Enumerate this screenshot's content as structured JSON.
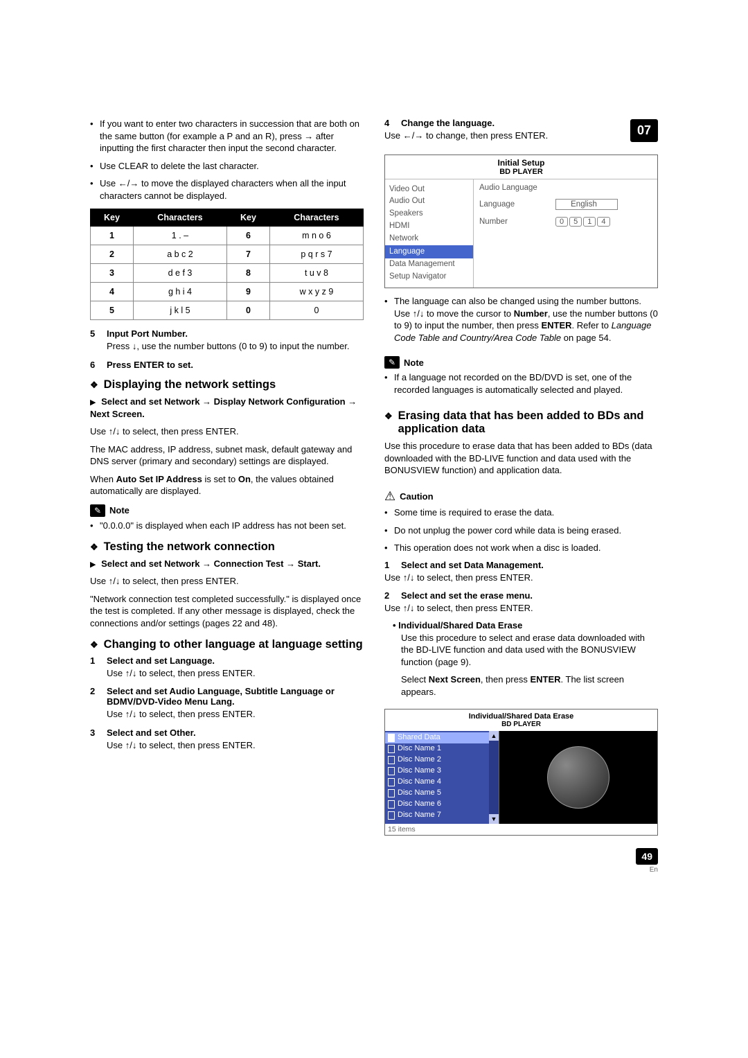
{
  "chapter": "07",
  "page_number": "49",
  "page_lang": "En",
  "left": {
    "bullets_top": [
      "If you want to enter two characters in succession that are both on the same button (for example a P and an R), press → after inputting the first character then input the second character.",
      "Use CLEAR to delete the last character.",
      "Use ←/→ to move the displayed characters when all the input characters cannot be displayed."
    ],
    "table": {
      "headers": [
        "Key",
        "Characters",
        "Key",
        "Characters"
      ],
      "rows": [
        [
          "1",
          "1 . –",
          "6",
          "m n o 6"
        ],
        [
          "2",
          "a b c 2",
          "7",
          "p q r s 7"
        ],
        [
          "3",
          "d e f 3",
          "8",
          "t u v 8"
        ],
        [
          "4",
          "g h i 4",
          "9",
          "w x y z 9"
        ],
        [
          "5",
          "j k l 5",
          "0",
          "0"
        ]
      ]
    },
    "step5": {
      "num": "5",
      "title": "Input Port Number.",
      "body": "Press ↓, use the number buttons (0 to 9) to input the number."
    },
    "step6": {
      "num": "6",
      "title": "Press ENTER to set."
    },
    "h_display": "Displaying the network settings",
    "display_sub": "Select and set Network → Display Network Configuration → Next Screen.",
    "display_use": "Use ↑/↓ to select, then press ENTER.",
    "display_p1": "The MAC address, IP address, subnet mask, default gateway and DNS server (primary and secondary) settings are displayed.",
    "display_p2a": "When ",
    "display_p2b": "Auto Set IP Address",
    "display_p2c": " is set to ",
    "display_p2d": "On",
    "display_p2e": ", the values obtained automatically are displayed.",
    "note_label": "Note",
    "display_note": "\"0.0.0.0\" is displayed when each IP address has not been set.",
    "h_test": "Testing the network connection",
    "test_sub": "Select and set Network → Connection Test → Start.",
    "test_use": "Use ↑/↓ to select, then press ENTER.",
    "test_p": "\"Network connection test completed successfully.\" is displayed once the test is completed. If any other message is displayed, check the connections and/or settings (pages 22 and 48).",
    "h_lang": "Changing to other language at language setting",
    "lang_s1": {
      "num": "1",
      "title": "Select and set Language.",
      "body": "Use ↑/↓ to select, then press ENTER."
    },
    "lang_s2": {
      "num": "2",
      "title": "Select and set Audio Language, Subtitle Language or BDMV/DVD-Video Menu Lang.",
      "body": "Use ↑/↓ to select, then press ENTER."
    },
    "lang_s3": {
      "num": "3",
      "title": "Select and set Other.",
      "body": "Use ↑/↓ to select, then press ENTER."
    }
  },
  "right": {
    "step4": {
      "num": "4",
      "title": "Change the language.",
      "body": "Use ←/→ to change, then press ENTER."
    },
    "screen1": {
      "title": "Initial Setup",
      "sub": "BD PLAYER",
      "left_items": [
        "Video Out",
        "Audio Out",
        "Speakers",
        "HDMI",
        "Network",
        "Language",
        "Data Management",
        "Setup Navigator"
      ],
      "selected": "Language",
      "r_lbl1": "Audio Language",
      "r_lbl2": "Language",
      "r_val2": "English",
      "r_lbl3": "Number",
      "r_nums": [
        "0",
        "5",
        "1",
        "4"
      ]
    },
    "after_screen_bullet_a": "The language can also be changed using the number buttons. Use ↑/↓ to move the cursor to ",
    "after_screen_bullet_b": "Number",
    "after_screen_bullet_c": ", use the number buttons (0 to 9) to input the number, then press ",
    "after_screen_bullet_d": "ENTER",
    "after_screen_bullet_e": ". Refer to ",
    "after_screen_bullet_f": "Language Code Table and Country/Area Code Table",
    "after_screen_bullet_g": " on page 54.",
    "note_label": "Note",
    "note_text": "If a language not recorded on the BD/DVD is set, one of the recorded languages is automatically selected and played.",
    "h_erase": "Erasing data that has been added to BDs and application data",
    "erase_p": "Use this procedure to erase data that has been added to BDs (data downloaded with the BD-LIVE function and data used with the BONUSVIEW function) and application data.",
    "caution_label": "Caution",
    "caution_items": [
      "Some time is required to erase the data.",
      "Do not unplug the power cord while data is being erased.",
      "This operation does not work when a disc is loaded."
    ],
    "es1": {
      "num": "1",
      "title": "Select and set Data Management.",
      "body": "Use ↑/↓ to select, then press ENTER."
    },
    "es2": {
      "num": "2",
      "title": "Select and set the erase menu.",
      "body": "Use ↑/↓ to select, then press ENTER."
    },
    "sub_title": "Individual/Shared Data Erase",
    "sub_p1": "Use this procedure to select and erase data downloaded with the BD-LIVE function and data used with the BONUSVIEW function (page 9).",
    "sub_p2a": "Select ",
    "sub_p2b": "Next Screen",
    "sub_p2c": ", then press ",
    "sub_p2d": "ENTER",
    "sub_p2e": ". The list screen appears.",
    "screen2": {
      "title": "Individual/Shared Data Erase",
      "sub": "BD PLAYER",
      "items": [
        "Shared Data",
        "Disc Name 1",
        "Disc Name 2",
        "Disc Name 3",
        "Disc Name 4",
        "Disc Name 5",
        "Disc Name 6",
        "Disc Name 7"
      ],
      "footer": "15 items"
    }
  }
}
